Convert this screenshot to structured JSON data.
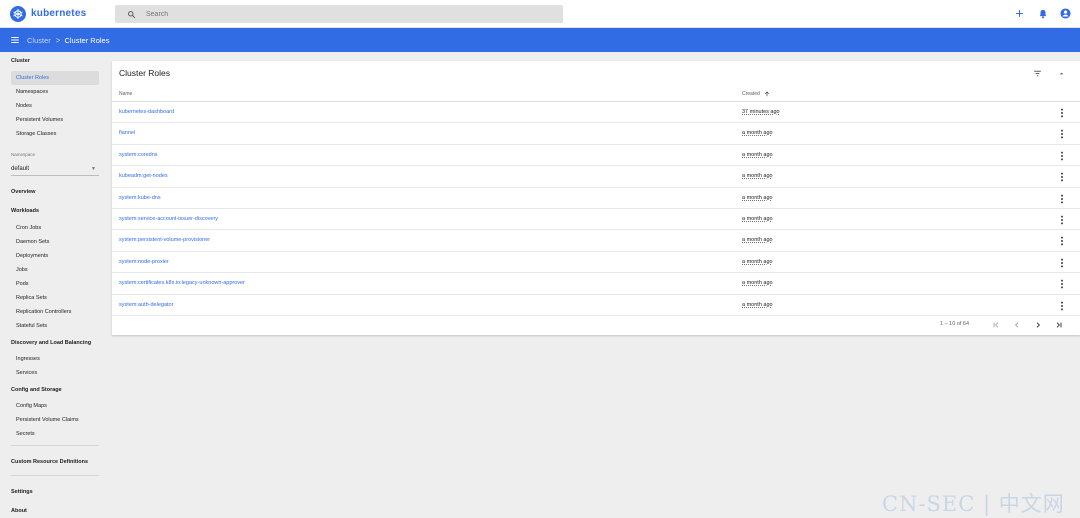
{
  "app": {
    "name": "kubernetes",
    "brand_color": "#326ce5",
    "icons": {
      "logo": "kubernetes-helm-icon",
      "add": "plus-icon",
      "notifications": "bell-icon",
      "account": "account-circle-icon"
    }
  },
  "search": {
    "placeholder": "Search",
    "value": ""
  },
  "breadcrumb": {
    "parent": "Cluster",
    "separator": ">",
    "current": "Cluster Roles"
  },
  "sidebar": {
    "cluster_header": "Cluster",
    "cluster_items": [
      "Cluster Roles",
      "Namespaces",
      "Nodes",
      "Persistent Volumes",
      "Storage Classes"
    ],
    "active_item": "Cluster Roles",
    "namespace_label": "Namespace",
    "namespace_value": "default",
    "overview": "Overview",
    "workloads_header": "Workloads",
    "workloads_items": [
      "Cron Jobs",
      "Daemon Sets",
      "Deployments",
      "Jobs",
      "Pods",
      "Replica Sets",
      "Replication Controllers",
      "Stateful Sets"
    ],
    "discovery_header": "Discovery and Load Balancing",
    "discovery_items": [
      "Ingresses",
      "Services"
    ],
    "config_header": "Config and Storage",
    "config_items": [
      "Config Maps",
      "Persistent Volume Claims",
      "Secrets"
    ],
    "crd": "Custom Resource Definitions",
    "settings": "Settings",
    "about": "About"
  },
  "card": {
    "title": "Cluster Roles",
    "columns": {
      "name": "Name",
      "created": "Created"
    },
    "rows": [
      {
        "name": "kubernetes-dashboard",
        "created": "37 minutes ago"
      },
      {
        "name": "flannel",
        "created": "a month ago"
      },
      {
        "name": "system:coredns",
        "created": "a month ago"
      },
      {
        "name": "kubeadm:get-nodes",
        "created": "a month ago"
      },
      {
        "name": "system:kube-dns",
        "created": "a month ago"
      },
      {
        "name": "system:service-account-issuer-discovery",
        "created": "a month ago"
      },
      {
        "name": "system:persistent-volume-provisioner",
        "created": "a month ago"
      },
      {
        "name": "system:node-proxier",
        "created": "a month ago"
      },
      {
        "name": "system:certificates.k8s.io:legacy-unknown-approver",
        "created": "a month ago"
      },
      {
        "name": "system:auth-delegator",
        "created": "a month ago"
      }
    ],
    "pagination": {
      "range": "1 – 10 of 64"
    }
  },
  "watermark": "CN-SEC | 中文网"
}
